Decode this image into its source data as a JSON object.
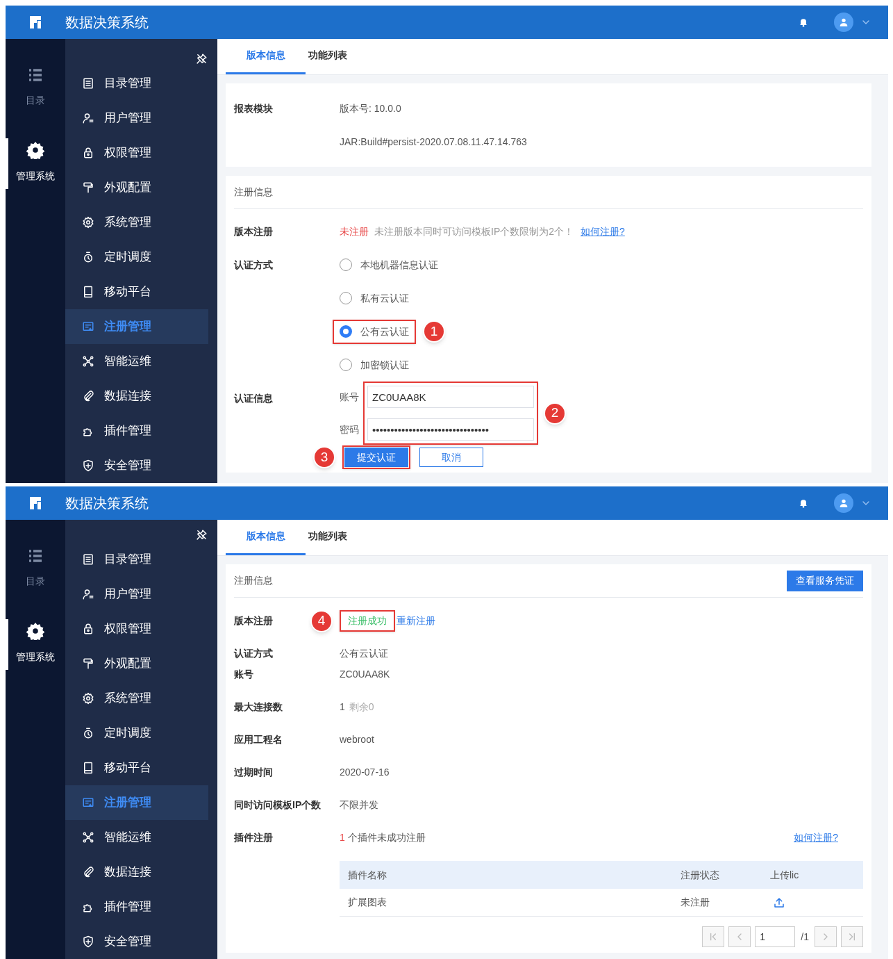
{
  "screens": [
    {
      "header": {
        "title": "数据决策系统"
      },
      "rail": [
        {
          "label": "目录",
          "selected": false
        },
        {
          "label": "管理系统",
          "selected": true
        }
      ],
      "menu": [
        {
          "label": "目录管理",
          "selected": false
        },
        {
          "label": "用户管理",
          "selected": false
        },
        {
          "label": "权限管理",
          "selected": false
        },
        {
          "label": "外观配置",
          "selected": false
        },
        {
          "label": "系统管理",
          "selected": false
        },
        {
          "label": "定时调度",
          "selected": false
        },
        {
          "label": "移动平台",
          "selected": false
        },
        {
          "label": "注册管理",
          "selected": true
        },
        {
          "label": "智能运维",
          "selected": false
        },
        {
          "label": "数据连接",
          "selected": false
        },
        {
          "label": "插件管理",
          "selected": false
        },
        {
          "label": "安全管理",
          "selected": false
        }
      ],
      "tabs": [
        {
          "label": "版本信息",
          "selected": true
        },
        {
          "label": "功能列表",
          "selected": false
        }
      ],
      "cards": [
        {
          "kind": "module",
          "label": "报表模块",
          "lines": [
            "版本号: 10.0.0",
            "JAR:Build#persist-2020.07.08.11.47.14.763"
          ]
        },
        {
          "kind": "form",
          "title": "注册信息",
          "status_label": "版本注册",
          "status": "未注册",
          "note": "未注册版本同时可访问模板IP个数限制为2个！",
          "help_link": "如何注册?",
          "method_label": "认证方式",
          "methods": [
            {
              "label": "本地机器信息认证",
              "selected": false
            },
            {
              "label": "私有云认证",
              "selected": false
            },
            {
              "label": "公有云认证",
              "selected": true,
              "callout": "1"
            },
            {
              "label": "加密锁认证",
              "selected": false
            }
          ],
          "auth_label": "认证信息",
          "fields_callout": "2",
          "fields": [
            {
              "label": "账号",
              "value": "ZC0UAA8K"
            },
            {
              "label": "密码",
              "value": "••••••••••••••••••••••••••••••••"
            }
          ],
          "buttons": [
            {
              "label": "提交认证",
              "primary": true,
              "callout": "3"
            },
            {
              "label": "取消",
              "primary": false
            }
          ]
        }
      ]
    },
    {
      "header": {
        "title": "数据决策系统"
      },
      "rail": [
        {
          "label": "目录",
          "selected": false
        },
        {
          "label": "管理系统",
          "selected": true
        }
      ],
      "menu": [
        {
          "label": "目录管理",
          "selected": false
        },
        {
          "label": "用户管理",
          "selected": false
        },
        {
          "label": "权限管理",
          "selected": false
        },
        {
          "label": "外观配置",
          "selected": false
        },
        {
          "label": "系统管理",
          "selected": false
        },
        {
          "label": "定时调度",
          "selected": false
        },
        {
          "label": "移动平台",
          "selected": false
        },
        {
          "label": "注册管理",
          "selected": true
        },
        {
          "label": "智能运维",
          "selected": false
        },
        {
          "label": "数据连接",
          "selected": false
        },
        {
          "label": "插件管理",
          "selected": false
        },
        {
          "label": "安全管理",
          "selected": false
        }
      ],
      "tabs": [
        {
          "label": "版本信息",
          "selected": true
        },
        {
          "label": "功能列表",
          "selected": false
        }
      ],
      "cards": [
        {
          "kind": "result",
          "title": "注册信息",
          "action": "查看服务凭证",
          "groups": [
            [
              {
                "kind": "status",
                "label": "版本注册",
                "status": "注册成功",
                "link": "重新注册",
                "callout": "4"
              }
            ],
            [
              {
                "kind": "text",
                "label": "认证方式",
                "value": "公有云认证"
              },
              {
                "kind": "text",
                "label": "账号",
                "value": "ZC0UAA8K"
              }
            ],
            [
              {
                "kind": "text",
                "label": "最大连接数",
                "value": "1",
                "extra": "剩余0"
              }
            ],
            [
              {
                "kind": "text",
                "label": "应用工程名",
                "value": "webroot"
              }
            ],
            [
              {
                "kind": "text",
                "label": "过期时间",
                "value": "2020-07-16"
              }
            ],
            [
              {
                "kind": "text",
                "label": "同时访问模板IP个数",
                "value": "不限并发"
              }
            ],
            [
              {
                "kind": "plugins",
                "label": "插件注册",
                "count": "1",
                "value": "个插件未成功注册",
                "link": "如何注册?"
              }
            ]
          ],
          "table": {
            "columns": [
              "插件名称",
              "注册状态",
              "上传lic"
            ],
            "rows": [
              {
                "name": "扩展图表",
                "status": "未注册"
              }
            ]
          },
          "pager": {
            "page": "1",
            "total": "/1"
          }
        }
      ]
    }
  ]
}
